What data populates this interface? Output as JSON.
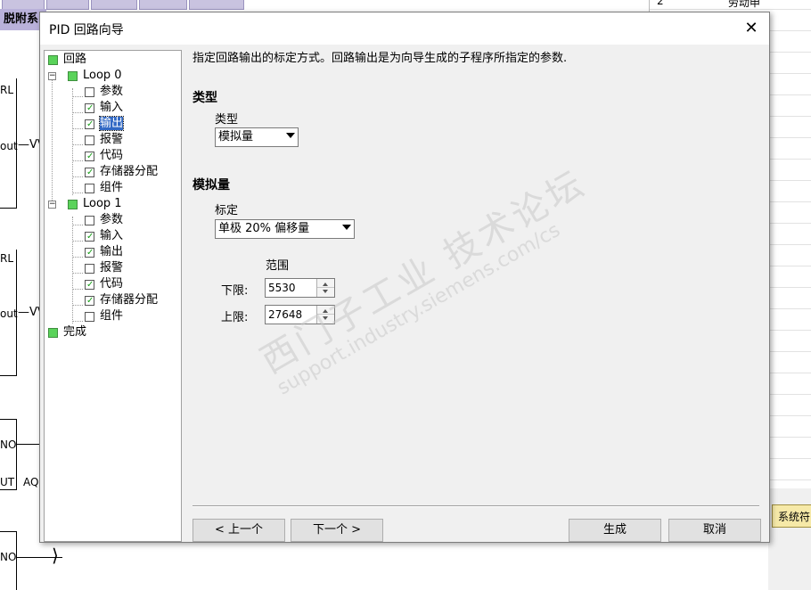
{
  "background": {
    "title_fragment": "脱附系",
    "ladder_labels": [
      "RL",
      "out",
      "RL",
      "out",
      "NO",
      "UT",
      "AQ",
      "NO"
    ],
    "right_panel_text": "劳动申",
    "right_panel_row_number": "2",
    "system_tab": "系统符"
  },
  "dialog": {
    "title": "PID 回路向导",
    "close_symbol": "✕"
  },
  "tree": {
    "root_label": "回路",
    "loops": [
      {
        "label": "Loop 0",
        "children": [
          "参数",
          "输入",
          "输出",
          "报警",
          "代码",
          "存储器分配",
          "组件"
        ],
        "checked": [
          false,
          true,
          true,
          false,
          true,
          true,
          false
        ]
      },
      {
        "label": "Loop 1",
        "children": [
          "参数",
          "输入",
          "输出",
          "报警",
          "代码",
          "存储器分配",
          "组件"
        ],
        "checked": [
          false,
          true,
          true,
          false,
          true,
          true,
          false
        ]
      }
    ],
    "finish_label": "完成",
    "selected": "Loop 0 / 输出"
  },
  "panel": {
    "description": "指定回路输出的标定方式。回路输出是为向导生成的子程序所指定的参数.",
    "type_section": "类型",
    "type_label": "类型",
    "type_value": "模拟量",
    "analog_section": "模拟量",
    "scaling_label": "标定",
    "scaling_value": "单极 20% 偏移量",
    "range_label": "范围",
    "low_label": "下限:",
    "low_value": "5530",
    "high_label": "上限:",
    "high_value": "27648"
  },
  "buttons": {
    "prev": "< 上一个",
    "next": "下一个 >",
    "generate": "生成",
    "cancel": "取消"
  },
  "watermark": {
    "text": "西门子工业 技术论坛",
    "url": "support.industry.siemens.com/cs"
  },
  "colors": {
    "selection": "#3168c4",
    "tree_green": "#5ad35a",
    "dialog_bg": "#f0f0f0"
  }
}
